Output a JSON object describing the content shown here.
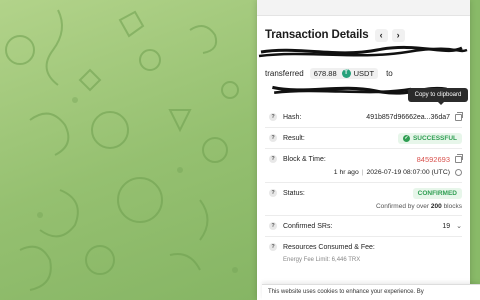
{
  "header": {
    "title": "Transaction Details",
    "prev_icon": "chevron-left-icon",
    "next_icon": "chevron-right-icon",
    "prev_glyph": "‹",
    "next_glyph": "›"
  },
  "summary": {
    "transferred_label": "transferred",
    "amount": "678.88",
    "token": "USDT",
    "token_icon_glyph": "T",
    "to_label": "to"
  },
  "tooltip": {
    "text": "Copy to clipboard"
  },
  "rows": {
    "hash": {
      "label": "Hash:",
      "value": "491b857d96662ea...36da7"
    },
    "result": {
      "label": "Result:",
      "value": "SUCCESSFUL",
      "check": "✓"
    },
    "block": {
      "label": "Block & Time:",
      "block_number": "84592693",
      "ago": "1 hr ago",
      "separator": "|",
      "datetime": "2026-07-19 08:07:00 (UTC)"
    },
    "status": {
      "label": "Status:",
      "value": "CONFIRMED",
      "confirm_prefix": "Confirmed by over",
      "confirm_count": "200",
      "confirm_suffix": "blocks"
    },
    "srs": {
      "label": "Confirmed SRs:",
      "value": "19",
      "chevron": "⌄"
    },
    "resources": {
      "label": "Resources Consumed & Fee:",
      "fee_limit": "Energy Fee Limit: 6,446 TRX"
    }
  },
  "help_glyph": "?",
  "cookie_banner": {
    "text": "This website uses cookies to enhance your experience. By"
  },
  "colors": {
    "success": "#2f9e52",
    "block_number": "#d9534f",
    "wallpaper": "#9cc47a"
  }
}
